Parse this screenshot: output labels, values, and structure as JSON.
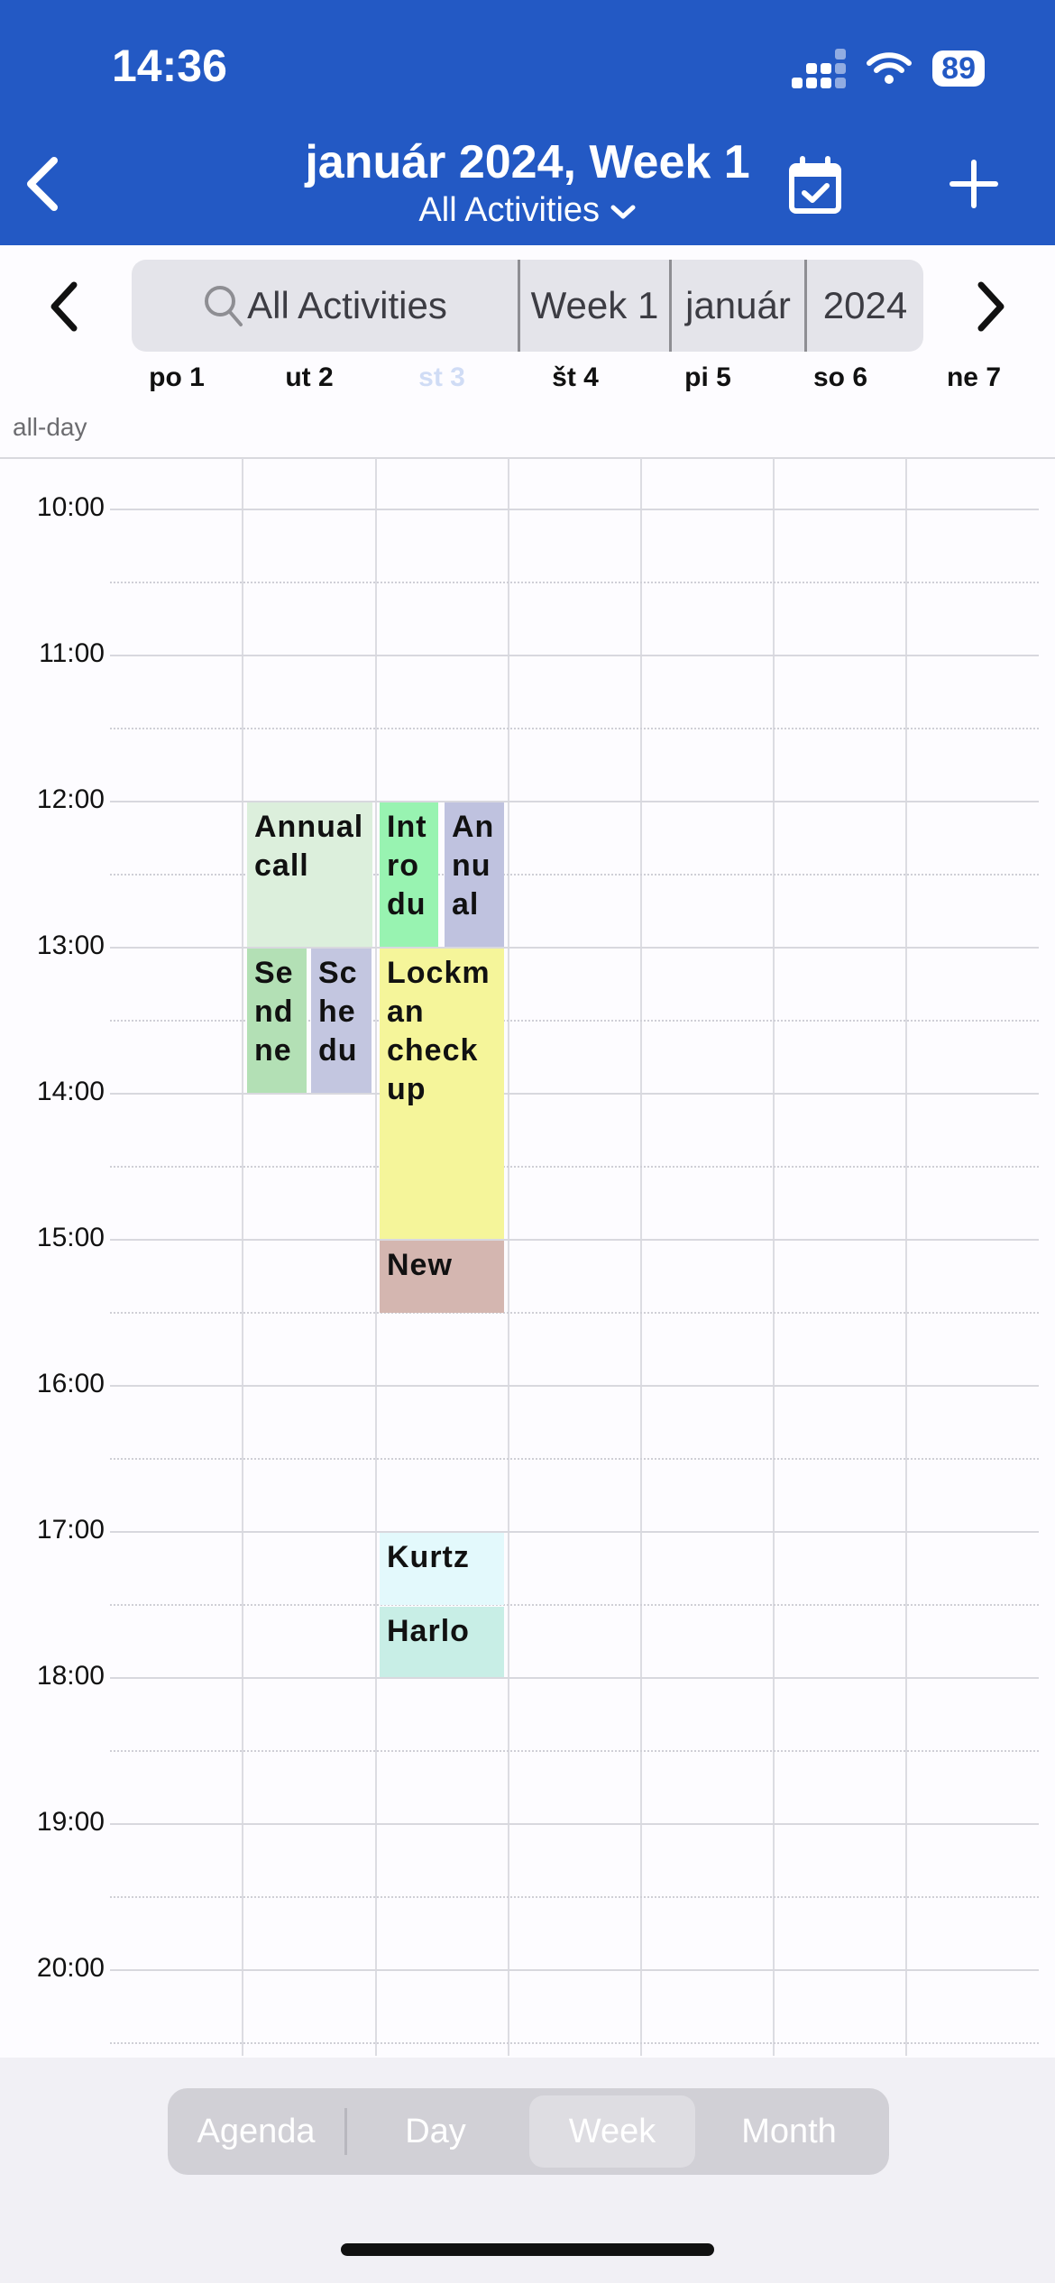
{
  "status_bar": {
    "time": "14:36",
    "battery": "89"
  },
  "header": {
    "title": "január 2024, Week 1",
    "subtitle": "All Activities",
    "subtitle_chevron": "⌄"
  },
  "filter_bar": {
    "search": "All Activities",
    "week": "Week 1",
    "month": "január",
    "year": "2024"
  },
  "days": [
    {
      "label": "po  1"
    },
    {
      "label": "ut  2"
    },
    {
      "label": "st  3"
    },
    {
      "label": "št  4"
    },
    {
      "label": "pi  5"
    },
    {
      "label": "so  6"
    },
    {
      "label": "ne  7"
    }
  ],
  "allday_label": "all-day",
  "hours": [
    "10:00",
    "11:00",
    "12:00",
    "13:00",
    "14:00",
    "15:00",
    "16:00",
    "17:00",
    "18:00",
    "19:00",
    "20:00"
  ],
  "events": [
    {
      "title": "Annual call",
      "color": "#dcefdc"
    },
    {
      "title": "Se nd ne",
      "color": "#b3e0b5"
    },
    {
      "title": "Sc he du",
      "color": "#c3c6e0"
    },
    {
      "title": "Int ro du",
      "color": "#98f3b1"
    },
    {
      "title": "An nu al",
      "color": "#bfc2df"
    },
    {
      "title": "Lockm an check up",
      "color": "#f5f59a"
    },
    {
      "title": "New",
      "color": "#d4b6b0"
    },
    {
      "title": "Kurtz",
      "color": "#e3f9fc"
    },
    {
      "title": "Harlo",
      "color": "#c8eee6"
    }
  ],
  "view_tabs": [
    "Agenda",
    "Day",
    "Week",
    "Month"
  ],
  "active_view": "Week",
  "colors": {
    "header_bg": "#2359c4",
    "today_label": "#d0dcf5"
  }
}
